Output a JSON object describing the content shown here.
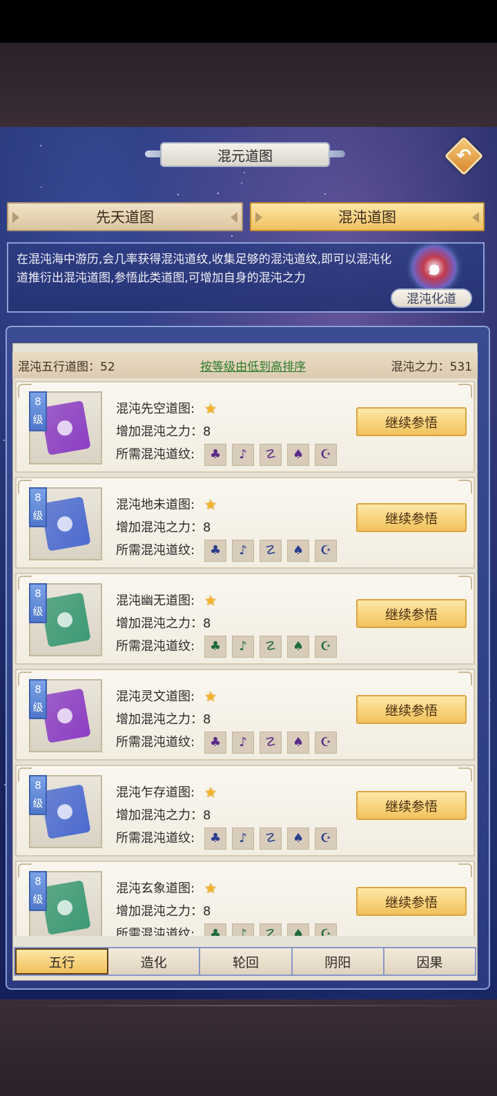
{
  "header": {
    "title": "混元道图"
  },
  "tabs_top": [
    {
      "label": "先天道图",
      "active": false
    },
    {
      "label": "混沌道图",
      "active": true
    }
  ],
  "description": {
    "text": "在混沌海中游历,会几率获得混沌道纹,收集足够的混沌道纹,即可以混沌化道推衍出混沌道图,参悟此类道图,可增加自身的混沌之力",
    "badge_label": "混沌化道"
  },
  "stats": {
    "left": "混沌五行道图：52",
    "sort_link": "按等级由低到高排序",
    "right": "混沌之力：531"
  },
  "cards": [
    {
      "level": "8\n级",
      "name": "混沌先空道图:",
      "power": "增加混沌之力：8",
      "req_label": "所需混沌道纹:",
      "button": "继续参悟",
      "color": "#8c3fc4",
      "glyph_color": "#5a2a8a"
    },
    {
      "level": "8\n级",
      "name": "混沌地未道图:",
      "power": "增加混沌之力：8",
      "req_label": "所需混沌道纹:",
      "button": "继续参悟",
      "color": "#4d6cd1",
      "glyph_color": "#2b3d8e"
    },
    {
      "level": "8\n级",
      "name": "混沌幽无道图:",
      "power": "增加混沌之力：8",
      "req_label": "所需混沌道纹:",
      "button": "继续参悟",
      "color": "#3c9a74",
      "glyph_color": "#1f6b3a"
    },
    {
      "level": "8\n级",
      "name": "混沌灵文道图:",
      "power": "增加混沌之力：8",
      "req_label": "所需混沌道纹:",
      "button": "继续参悟",
      "color": "#8c3fc4",
      "glyph_color": "#5a2a8a"
    },
    {
      "level": "8\n级",
      "name": "混沌乍存道图:",
      "power": "增加混沌之力：8",
      "req_label": "所需混沌道纹:",
      "button": "继续参悟",
      "color": "#4d6cd1",
      "glyph_color": "#2b3d8e"
    },
    {
      "level": "8\n级",
      "name": "混沌玄象道图:",
      "power": "增加混沌之力：8",
      "req_label": "所需混沌道纹:",
      "button": "继续参悟",
      "color": "#3c9a74",
      "glyph_color": "#1f6b3a"
    }
  ],
  "bottom_tabs": [
    {
      "label": "五行",
      "active": true
    },
    {
      "label": "造化",
      "active": false
    },
    {
      "label": "轮回",
      "active": false
    },
    {
      "label": "阴阳",
      "active": false
    },
    {
      "label": "因果",
      "active": false
    }
  ],
  "icons": {
    "back": "back-arrow-icon",
    "star": "star-icon",
    "glyph": "rune-icon"
  }
}
